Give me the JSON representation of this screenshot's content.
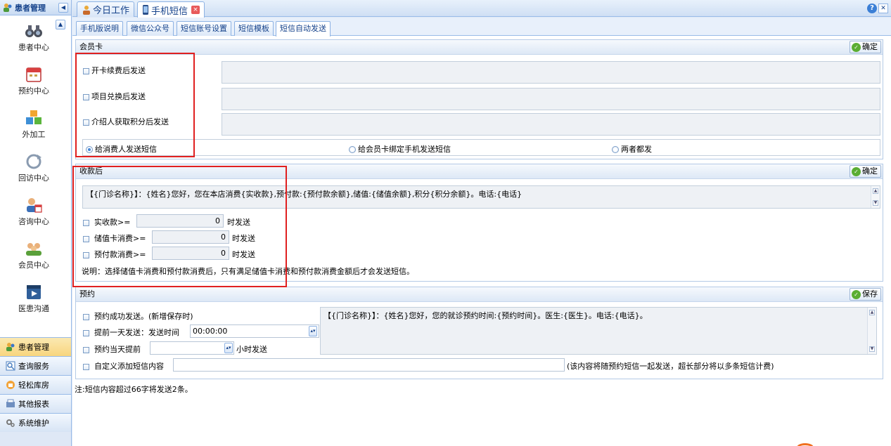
{
  "left_panel": {
    "title": "患者管理",
    "nav_items": [
      {
        "label": "患者中心",
        "icon": "binoculars-icon"
      },
      {
        "label": "预约中心",
        "icon": "calendar-icon"
      },
      {
        "label": "外加工",
        "icon": "cubes-icon"
      },
      {
        "label": "回访中心",
        "icon": "refresh-icon"
      },
      {
        "label": "咨询中心",
        "icon": "consult-user-icon"
      },
      {
        "label": "会员中心",
        "icon": "members-icon"
      },
      {
        "label": "医患沟通",
        "icon": "media-play-icon"
      }
    ],
    "sections": [
      {
        "label": "患者管理",
        "icon": "patients-icon",
        "active": true
      },
      {
        "label": "查询服务",
        "icon": "query-icon",
        "active": false
      },
      {
        "label": "轻松库房",
        "icon": "warehouse-icon",
        "active": false
      },
      {
        "label": "其他报表",
        "icon": "report-icon",
        "active": false
      },
      {
        "label": "系统维护",
        "icon": "settings-icon",
        "active": false
      }
    ]
  },
  "top_tabs": [
    {
      "label": "今日工作",
      "icon": "person-work-icon",
      "active": false
    },
    {
      "label": "手机短信",
      "icon": "phone-icon",
      "active": true,
      "closable": true
    }
  ],
  "sub_tabs": [
    {
      "label": "手机版说明",
      "active": false
    },
    {
      "label": "微信公众号",
      "active": false
    },
    {
      "label": "短信账号设置",
      "active": false
    },
    {
      "label": "短信模板",
      "active": false
    },
    {
      "label": "短信自动发送",
      "active": true
    }
  ],
  "member_card": {
    "title": "会员卡",
    "confirm_label": "确定",
    "options": [
      {
        "label": "开卡续费后发送",
        "text": ""
      },
      {
        "label": "项目兑换后发送",
        "text": ""
      },
      {
        "label": "介绍人获取积分后发送",
        "text": ""
      }
    ],
    "radios": [
      {
        "label": "给消费人发送短信",
        "checked": true
      },
      {
        "label": "给会员卡绑定手机发送短信",
        "checked": false
      },
      {
        "label": "两者都发",
        "checked": false
      }
    ]
  },
  "payment": {
    "title": "收款后",
    "confirm_label": "确定",
    "template": "【{门诊名称}】：{姓名}您好，您在本店消费{实收款},预付款:{预付款余额},储值:{储值余额},积分{积分余额}。电话:{电话}",
    "rows": [
      {
        "label": "实收款>=",
        "value": "0",
        "suffix": "时发送"
      },
      {
        "label": "储值卡消费>=",
        "value": "0",
        "suffix": "时发送"
      },
      {
        "label": "预付款消费>=",
        "value": "0",
        "suffix": "时发送"
      }
    ],
    "note": "说明：选择储值卡消费和预付款消费后，只有满足储值卡消费和预付款消费金额后才会发送短信。"
  },
  "appointment": {
    "title": "预约",
    "save_label": "保存",
    "success_label": "预约成功发送。(新增保存时)",
    "day_before_label": "提前一天发送：发送时间",
    "day_before_time": "00:00:00",
    "same_day_label": "预约当天提前",
    "same_day_value": "",
    "same_day_suffix": "小时发送",
    "custom_label": "自定义添加短信内容",
    "custom_value": "",
    "custom_hint": "(该内容将随预约短信一起发送，超长部分将以多条短信计费)",
    "template": "【{门诊名称}】：{姓名}您好，您的就诊预约时间:{预约时间}。医生:{医生}。电话:{电话}。"
  },
  "footer_note": "注:短信内容超过66字将发送2条。",
  "colors": {
    "header_text": "#15428b",
    "panel_border": "#99bbe8",
    "annotation_red": "#e02020",
    "ok_green": "#5aad32"
  }
}
